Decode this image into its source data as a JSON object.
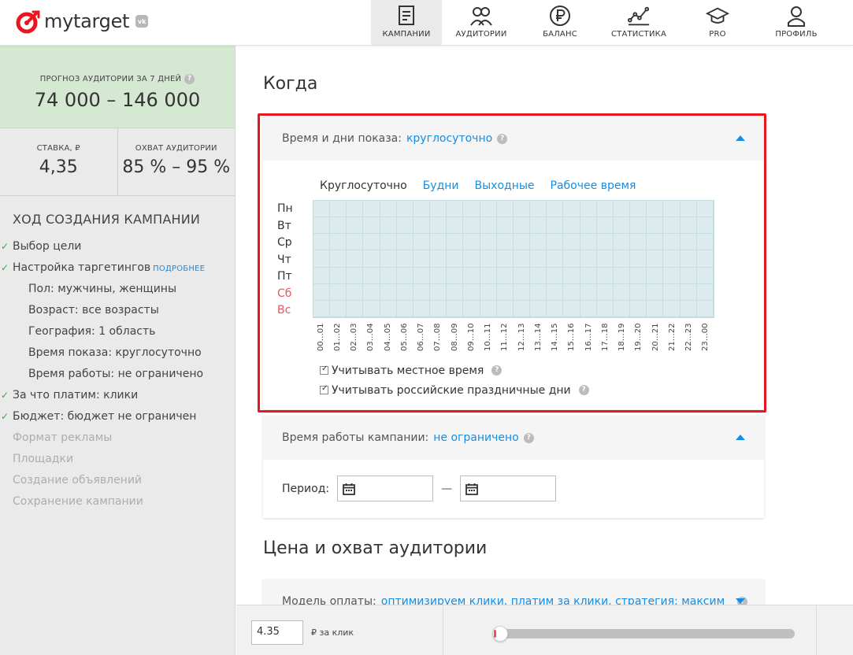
{
  "brand": {
    "logo_text": "mytarget",
    "vk_badge": "vk",
    "accent_color": "#168de2",
    "logo_color": "#e8161e"
  },
  "nav": {
    "items": [
      {
        "label": "КАМПАНИИ",
        "icon": "campaigns-doc-icon",
        "active": true
      },
      {
        "label": "АУДИТОРИИ",
        "icon": "audiences-people-icon"
      },
      {
        "label": "БАЛАНС",
        "icon": "ruble-coin-icon"
      },
      {
        "label": "СТАТИСТИКА",
        "icon": "statistics-chart-icon"
      },
      {
        "label": "PRO",
        "icon": "graduation-cap-icon"
      },
      {
        "label": "ПРОФИЛЬ",
        "icon": "profile-person-icon"
      }
    ]
  },
  "sidebar": {
    "forecast_title": "ПРОГНОЗ АУДИТОРИИ ЗА 7 ДНЕЙ",
    "forecast_value": "74 000 – 146 000",
    "bid_label": "СТАВКА, ₽",
    "bid_value": "4,35",
    "reach_label": "ОХВАТ АУДИТОРИИ",
    "reach_value": "85 % – 95 %",
    "progress_title": "ХОД СОЗДАНИЯ КАМПАНИИ",
    "steps": {
      "goal": "Выбор цели",
      "targeting": "Настройка таргетингов",
      "targeting_more": "ПОДРОБНЕЕ",
      "gender": "Пол: мужчины, женщины",
      "age": "Возраст: все возрасты",
      "geo": "География: 1 область",
      "show_time": "Время показа: круглосуточно",
      "work_time": "Время работы: не ограничено",
      "pay_for": "За что платим: клики",
      "budget": "Бюджет: бюджет не ограничен",
      "format": "Формат рекламы",
      "platforms": "Площадки",
      "ads": "Создание объявлений",
      "save": "Сохранение кампании"
    }
  },
  "when_section": {
    "title": "Когда",
    "schedule_panel": {
      "label": "Время и дни показа:",
      "value": "круглосуточно",
      "presets": [
        "Круглосуточно",
        "Будни",
        "Выходные",
        "Рабочее время"
      ],
      "days": [
        "Пн",
        "Вт",
        "Ср",
        "Чт",
        "Пт",
        "Сб",
        "Вс"
      ],
      "hours": [
        "00…01",
        "01…02",
        "02…03",
        "03…04",
        "04…05",
        "05…06",
        "06…07",
        "07…08",
        "08…09",
        "09…10",
        "10…11",
        "11…12",
        "12…13",
        "13…14",
        "14…15",
        "15…16",
        "16…17",
        "17…18",
        "18…19",
        "19…20",
        "20…21",
        "21…22",
        "22…23",
        "23…00"
      ],
      "local_time_label": "Учитывать местное время",
      "local_time_checked": true,
      "holidays_label": "Учитывать российские праздничные дни",
      "holidays_checked": true
    },
    "campaign_time_panel": {
      "label": "Время работы кампании:",
      "value": "не ограничено",
      "period_label": "Период:",
      "dash": "—"
    }
  },
  "price_section": {
    "title": "Цена и охват аудитории",
    "payment_label": "Модель оплаты:",
    "payment_value": "оптимизируем клики, платим за клики, стратегия: максим"
  },
  "bottom_bar": {
    "bid_value": "4.35",
    "bid_unit": "₽ за клик",
    "slider_level": 0
  }
}
